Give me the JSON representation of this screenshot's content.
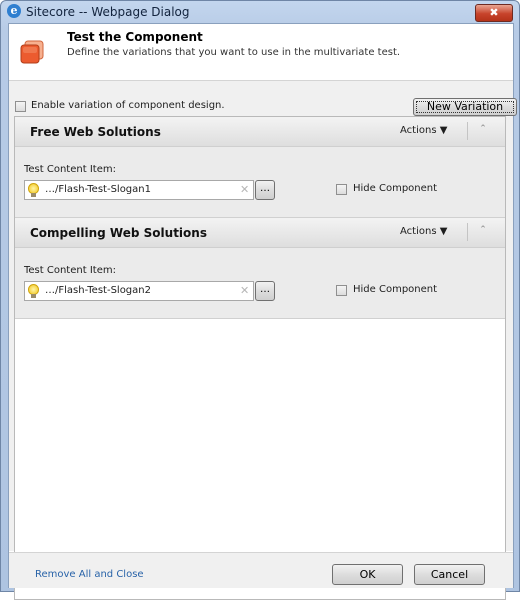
{
  "window": {
    "title": "Sitecore -- Webpage Dialog",
    "close_label": "✖"
  },
  "header": {
    "title": "Test the Component",
    "subtitle": "Define the variations that you want to use in the multivariate test."
  },
  "options": {
    "enable_label": "Enable variation of component design.",
    "new_variation_label": "New Variation"
  },
  "variations": [
    {
      "name": "Free Web Solutions",
      "actions_label": "Actions ▼",
      "collapse_icon": "⌃",
      "content_label": "Test Content Item:",
      "content_value": "…/Flash-Test-Slogan1",
      "clear_icon": "✕",
      "browse_label": "…",
      "hide_label": "Hide Component"
    },
    {
      "name": "Compelling Web Solutions",
      "actions_label": "Actions ▼",
      "collapse_icon": "⌃",
      "content_label": "Test Content Item:",
      "content_value": "…/Flash-Test-Slogan2",
      "clear_icon": "✕",
      "browse_label": "…",
      "hide_label": "Hide Component"
    }
  ],
  "footer": {
    "remove_label": "Remove All and Close",
    "ok_label": "OK",
    "cancel_label": "Cancel"
  }
}
